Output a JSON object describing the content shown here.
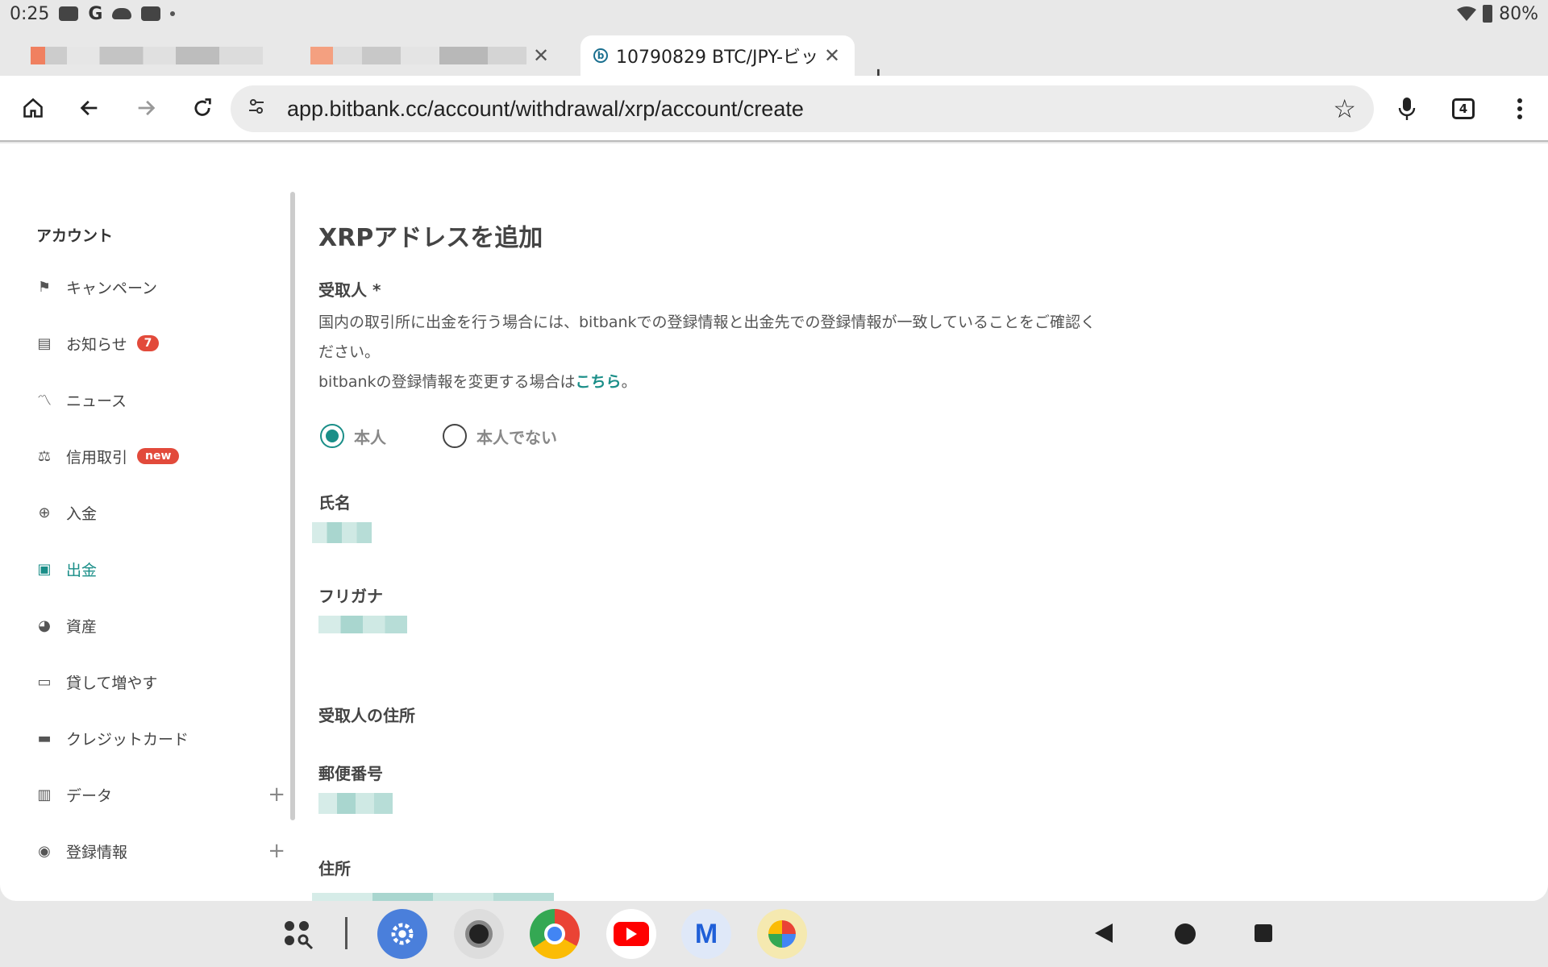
{
  "status_bar": {
    "time": "0:25",
    "battery": "80%"
  },
  "tabs": {
    "active_title": "10790829 BTC/JPY-ビッ",
    "close_symbol": "✕",
    "new_tab_symbol": "+",
    "count": "4"
  },
  "toolbar": {
    "url": "app.bitbank.cc/account/withdrawal/xrp/account/create"
  },
  "sidebar": {
    "title": "アカウント",
    "items": [
      {
        "label": "キャンペーン",
        "icon": "flag-icon"
      },
      {
        "label": "お知らせ",
        "icon": "message-icon",
        "badge": "7"
      },
      {
        "label": "ニュース",
        "icon": "chart-icon"
      },
      {
        "label": "信用取引",
        "icon": "scale-icon",
        "badge": "new"
      },
      {
        "label": "入金",
        "icon": "plus-circle-icon"
      },
      {
        "label": "出金",
        "icon": "wallet-icon",
        "active": true
      },
      {
        "label": "資産",
        "icon": "pie-icon"
      },
      {
        "label": "貸して増やす",
        "icon": "cash-icon"
      },
      {
        "label": "クレジットカード",
        "icon": "card-icon"
      },
      {
        "label": "データ",
        "icon": "clipboard-icon",
        "expand": "+"
      },
      {
        "label": "登録情報",
        "icon": "account-icon",
        "expand": "+"
      }
    ]
  },
  "main": {
    "heading": "XRPアドレスを追加",
    "recipient_label": "受取人 *",
    "notice_line1": "国内の取引所に出金を行う場合には、bitbankでの登録情報と出金先での登録情報が一致していることをご確認く",
    "notice_line2": "ださい。",
    "notice_line3_prefix": "bitbankの登録情報を変更する場合は",
    "notice_link": "こちら",
    "notice_line3_suffix": "。",
    "radio_self": "本人",
    "radio_not_self": "本人でない",
    "name_label": "氏名",
    "furigana_label": "フリガナ",
    "address_section": "受取人の住所",
    "postal_label": "郵便番号",
    "address_label": "住所"
  },
  "colors": {
    "accent": "#1a8e88",
    "badge": "#e24a3b"
  }
}
